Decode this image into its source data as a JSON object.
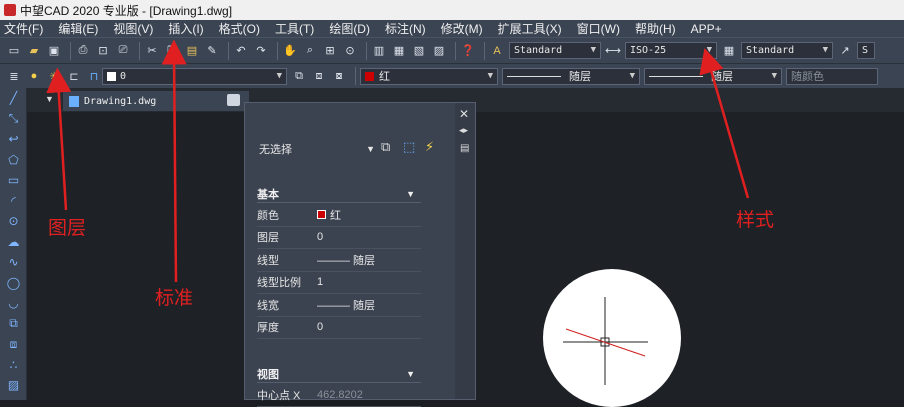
{
  "title": "中望CAD 2020 专业版 - [Drawing1.dwg]",
  "menu": [
    "文件(F)",
    "编辑(E)",
    "视图(V)",
    "插入(I)",
    "格式(O)",
    "工具(T)",
    "绘图(D)",
    "标注(N)",
    "修改(M)",
    "扩展工具(X)",
    "窗口(W)",
    "帮助(H)",
    "APP+"
  ],
  "toolbar1": {
    "text_style": "Standard",
    "dim_style": "ISO-25",
    "table_style": "Standard",
    "extra": "S"
  },
  "toolbar2": {
    "layer_value": "0",
    "color_value": "红",
    "linetype_value": "随层",
    "lineweight_value": "随层",
    "plotstyle_value": "随颜色"
  },
  "tab": {
    "label": "Drawing1.dwg"
  },
  "properties": {
    "selection": "无选择",
    "basic_header": "基本",
    "rows": [
      {
        "label": "颜色",
        "value": "红"
      },
      {
        "label": "图层",
        "value": "0"
      },
      {
        "label": "线型",
        "value": "——— 随层"
      },
      {
        "label": "线型比例",
        "value": "1"
      },
      {
        "label": "线宽",
        "value": "——— 随层"
      },
      {
        "label": "厚度",
        "value": "0"
      }
    ],
    "view_header": "视图",
    "view_rows": [
      {
        "label": "中心点 X",
        "value": "462.8202"
      }
    ]
  },
  "annotations": {
    "layer": "图层",
    "standard": "标准",
    "style": "样式"
  },
  "colors": {
    "ui_bg": "#3b4453",
    "canvas": "#1e2126",
    "annotation": "#e02020",
    "red_swatch": "#cc0000"
  }
}
